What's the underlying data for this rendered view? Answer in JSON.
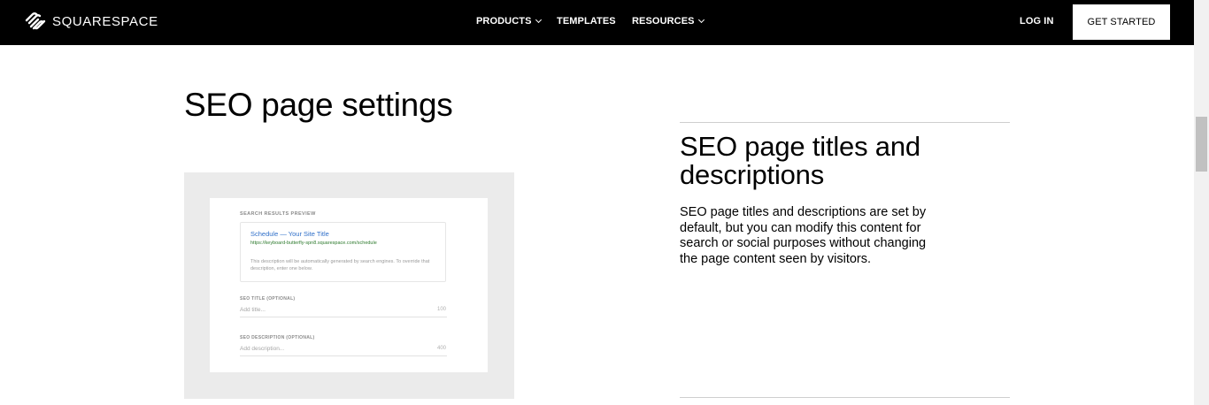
{
  "nav": {
    "brand": "SQUARESPACE",
    "links": [
      {
        "label": "PRODUCTS",
        "dropdown": true
      },
      {
        "label": "TEMPLATES",
        "dropdown": false
      },
      {
        "label": "RESOURCES",
        "dropdown": true
      }
    ],
    "login": "LOG IN",
    "cta": "GET STARTED"
  },
  "section": {
    "title": "SEO page settings"
  },
  "preview": {
    "label": "SEARCH RESULTS PREVIEW",
    "result_title": "Schedule — Your Site Title",
    "result_url": "https://keyboard-butterfly-spn8.squarespace.com/schedule",
    "result_desc": "This description will be automatically generated by search engines. To override that description, enter one below.",
    "seo_title_label": "SEO TITLE (OPTIONAL)",
    "seo_title_placeholder": "Add title...",
    "seo_title_count": "100",
    "seo_desc_label": "SEO DESCRIPTION (OPTIONAL)",
    "seo_desc_placeholder": "Add description...",
    "seo_desc_count": "400"
  },
  "feature": {
    "title": "SEO page titles and descriptions",
    "body": "SEO page titles and descriptions are set by default, but you can modify this content for search or social purposes without changing the page content seen by visitors."
  },
  "colors": {
    "nav_bg": "#000000",
    "link_blue": "#2f6fc9",
    "url_green": "#2d7a2d",
    "frame_gray": "#ebebeb"
  }
}
